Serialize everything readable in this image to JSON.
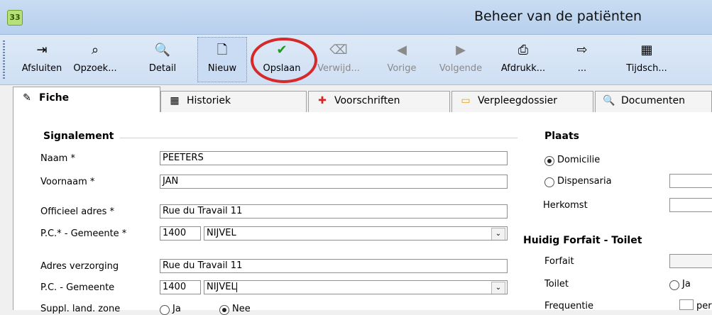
{
  "window": {
    "app_icon_text": "33",
    "title": "Beheer van de patiënten"
  },
  "toolbar": {
    "buttons": [
      {
        "label": "Afsluiten",
        "icon": "exit-door-icon",
        "glyph": "⇥",
        "state": "enabled"
      },
      {
        "label": "Opzoek...",
        "icon": "binoculars-icon",
        "glyph": "⌕",
        "state": "enabled"
      },
      {
        "label": "Detail",
        "icon": "magnifier-doc-icon",
        "glyph": "🔍",
        "state": "enabled"
      },
      {
        "label": "Nieuw",
        "icon": "new-document-icon",
        "glyph": "🗋",
        "state": "active"
      },
      {
        "label": "Opslaan",
        "icon": "checkmark-icon",
        "glyph": "✔",
        "state": "enabled"
      },
      {
        "label": "Verwijd...",
        "icon": "eraser-icon",
        "glyph": "⌫",
        "state": "disabled"
      },
      {
        "label": "Vorige",
        "icon": "arrow-left-icon",
        "glyph": "◀",
        "state": "disabled"
      },
      {
        "label": "Volgende",
        "icon": "arrow-right-icon",
        "glyph": "▶",
        "state": "disabled"
      },
      {
        "label": "Afdrukk...",
        "icon": "printer-icon",
        "glyph": "⎙",
        "state": "enabled"
      },
      {
        "label": "...",
        "icon": "export-arrow-icon",
        "glyph": "⇨",
        "state": "enabled"
      },
      {
        "label": "Tijdsch...",
        "icon": "calendar-icon",
        "glyph": "▦",
        "state": "enabled"
      }
    ]
  },
  "tabs": [
    {
      "label": "Fiche",
      "icon": "edit-card-icon",
      "glyph": "✎"
    },
    {
      "label": "Historiek",
      "icon": "history-calendar-icon",
      "glyph": "▦"
    },
    {
      "label": "Voorschriften",
      "icon": "medical-kit-icon",
      "glyph": "✚"
    },
    {
      "label": "Verpleegdossier",
      "icon": "folder-icon",
      "glyph": "▭"
    },
    {
      "label": "Documenten",
      "icon": "document-search-icon",
      "glyph": "🔍"
    }
  ],
  "signalement": {
    "title": "Signalement",
    "naam_label": "Naam *",
    "naam_value": "PEETERS",
    "voornaam_label": "Voornaam *",
    "voornaam_value": "JAN",
    "adres_label": "Officieel adres *",
    "adres_value": "Rue du Travail 11",
    "pc_label": "P.C.* - Gemeente *",
    "pc_value": "1400",
    "gemeente_value": "NIJVEL",
    "verzorging_label": "Adres verzorging",
    "verzorging_value": "Rue du Travail 11",
    "pc2_label": "P.C. - Gemeente",
    "pc2_value": "1400",
    "gemeente2_value": "NIJVEL",
    "suppl_label": "Suppl. land. zone",
    "suppl_ja": "Ja",
    "suppl_nee": "Nee"
  },
  "plaats": {
    "title": "Plaats",
    "domicilie": "Domicilie",
    "dispensaria": "Dispensaria",
    "herkomst_label": "Herkomst"
  },
  "forfait": {
    "title": "Huidig Forfait - Toilet",
    "forfait_label": "Forfait",
    "toilet_label": "Toilet",
    "toilet_ja": "Ja",
    "frequentie_label": "Frequentie",
    "frequentie_tail": "per"
  }
}
